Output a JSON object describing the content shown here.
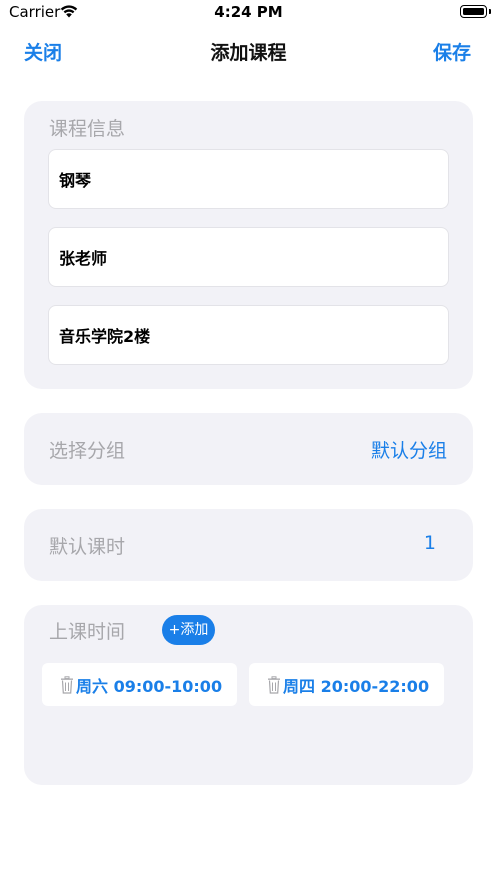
{
  "status_bar": {
    "carrier": "Carrier",
    "time": "4:24 PM"
  },
  "nav": {
    "close_label": "关闭",
    "title": "添加课程",
    "save_label": "保存"
  },
  "course_info": {
    "section_label": "课程信息",
    "fields": [
      {
        "value": "钢琴"
      },
      {
        "value": "张老师"
      },
      {
        "value": "音乐学院2楼"
      }
    ]
  },
  "group": {
    "label": "选择分组",
    "value": "默认分组"
  },
  "default_hours": {
    "label": "默认课时",
    "value": "1"
  },
  "class_time": {
    "label": "上课时间",
    "add_label": "+添加",
    "slots": [
      {
        "text": "周六 09:00-10:00"
      },
      {
        "text": "周四 20:00-22:00"
      }
    ]
  },
  "colors": {
    "accent": "#1a7fe8",
    "card_bg": "#f2f2f7",
    "label_gray": "#a7a7ab"
  },
  "icons": {
    "wifi": "wifi-icon",
    "battery": "battery-icon",
    "trash": "trash-icon"
  }
}
